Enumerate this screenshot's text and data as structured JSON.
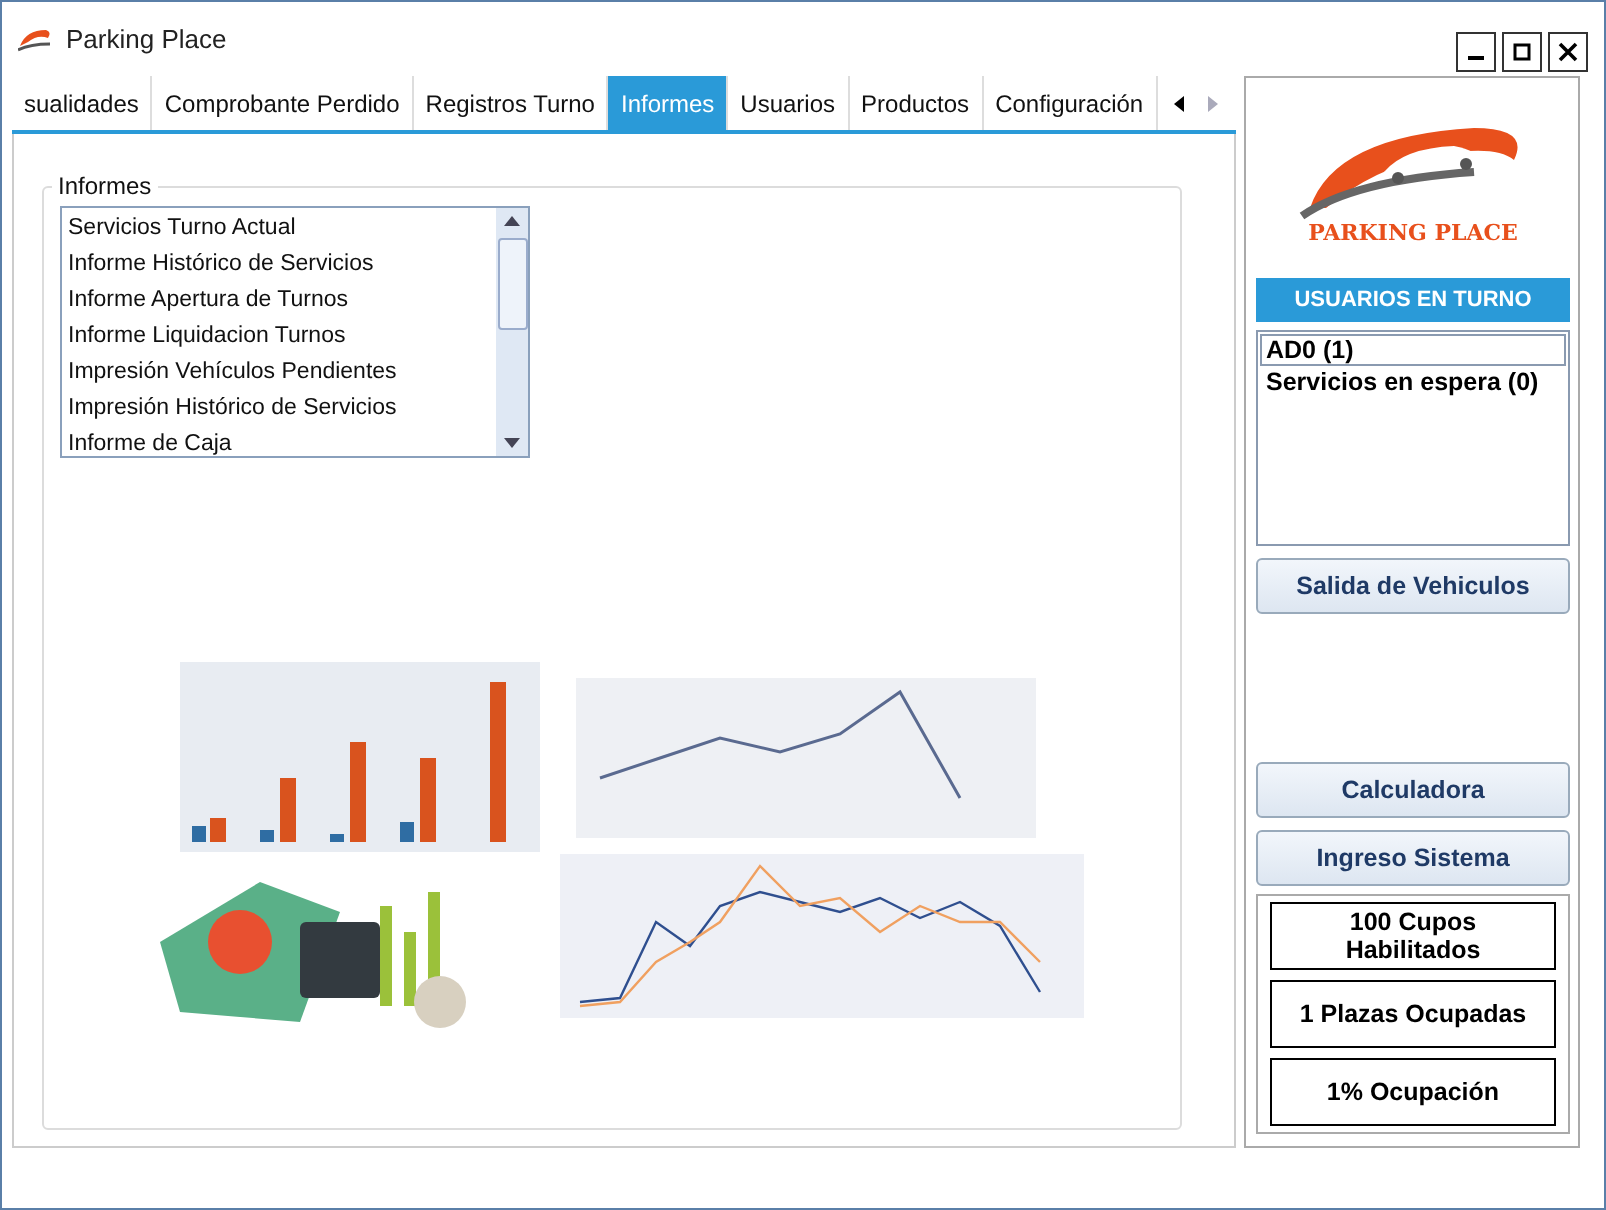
{
  "window": {
    "title": "Parking Place"
  },
  "tabs": [
    {
      "label": "sualidades",
      "selected": false
    },
    {
      "label": "Comprobante Perdido",
      "selected": false
    },
    {
      "label": "Registros Turno",
      "selected": false
    },
    {
      "label": "Informes",
      "selected": true
    },
    {
      "label": "Usuarios",
      "selected": false
    },
    {
      "label": "Productos",
      "selected": false
    },
    {
      "label": "Configuración",
      "selected": false
    }
  ],
  "reports": {
    "title": "Informes",
    "items": [
      "Servicios Turno Actual",
      "Informe Histórico de Servicios",
      "Informe Apertura de Turnos",
      "Informe Liquidacion Turnos",
      "Impresión Vehículos Pendientes",
      "Impresión Histórico de Servicios",
      "Informe de Caja"
    ]
  },
  "sidebar": {
    "logo_text": "PARKING PLACE",
    "users_header": "USUARIOS EN TURNO",
    "users": [
      {
        "label": "AD0 (1)",
        "selected": true
      },
      {
        "label": "Servicios en espera (0)",
        "selected": false
      }
    ],
    "exit_button": "Salida de Vehiculos",
    "buttons": [
      "Calculadora",
      "Ingreso Sistema"
    ],
    "stats": [
      "100 Cupos Habilitados",
      "1 Plazas Ocupadas",
      "1% Ocupación"
    ]
  }
}
